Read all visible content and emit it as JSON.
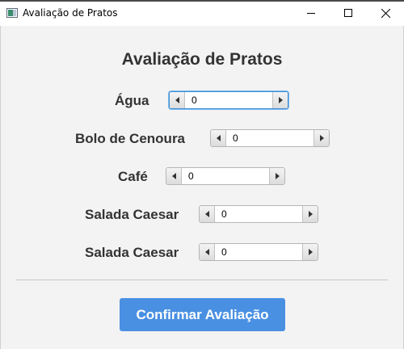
{
  "window": {
    "title": "Avaliação de Pratos",
    "icon": "java-app-icon"
  },
  "heading": "Avaliação de Pratos",
  "dishes": [
    {
      "label": "Água",
      "value": "0"
    },
    {
      "label": "Bolo de Cenoura",
      "value": "0"
    },
    {
      "label": "Café",
      "value": "0"
    },
    {
      "label": "Salada Caesar",
      "value": "0"
    },
    {
      "label": "Salada Caesar",
      "value": "0"
    }
  ],
  "confirm_label": "Confirmar Avaliação",
  "colors": {
    "accent": "#4a90e2",
    "focus": "#3e8ed6",
    "label_text": "#333333",
    "background": "#f3f3f3"
  }
}
